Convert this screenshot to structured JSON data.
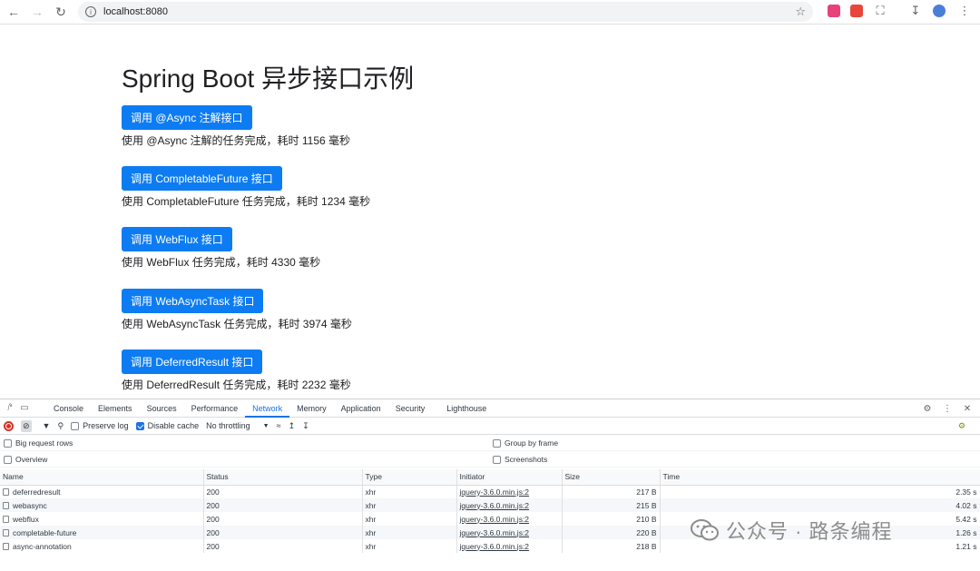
{
  "browser": {
    "url": "localhost:8080",
    "back_icon": "back-arrow-icon",
    "forward_icon": "forward-arrow-icon",
    "reload_icon": "reload-icon"
  },
  "page": {
    "title": "Spring Boot 异步接口示例",
    "demos": [
      {
        "button": "调用 @Async 注解接口",
        "result": "使用 @Async 注解的任务完成，耗时 1156 毫秒"
      },
      {
        "button": "调用 CompletableFuture 接口",
        "result": "使用 CompletableFuture 任务完成，耗时 1234 毫秒"
      },
      {
        "button": "调用 WebFlux 接口",
        "result": "使用 WebFlux 任务完成，耗时 4330 毫秒"
      },
      {
        "button": "调用 WebAsyncTask 接口",
        "result": "使用 WebAsyncTask 任务完成，耗时 3974 毫秒"
      },
      {
        "button": "调用 DeferredResult 接口",
        "result": "使用 DeferredResult 任务完成，耗时 2232 毫秒"
      }
    ],
    "button_color": "#0d7cf2"
  },
  "devtools": {
    "tabs": [
      "Console",
      "Elements",
      "Sources",
      "Performance",
      "Network",
      "Memory",
      "Application",
      "Security",
      "Lighthouse"
    ],
    "active_tab": "Network",
    "toolbar": {
      "preserve_log": "Preserve log",
      "disable_cache": "Disable cache",
      "throttling": "No throttling"
    },
    "options": {
      "big_rows": "Big request rows",
      "group_by_frame": "Group by frame",
      "overview": "Overview",
      "screenshots": "Screenshots"
    },
    "columns": [
      "Name",
      "Status",
      "Type",
      "Initiator",
      "Size",
      "Time"
    ],
    "rows": [
      {
        "name": "deferredresult",
        "status": "200",
        "type": "xhr",
        "initiator": "jquery-3.6.0.min.js:2",
        "size": "217 B",
        "time": "2.35 s"
      },
      {
        "name": "webasync",
        "status": "200",
        "type": "xhr",
        "initiator": "jquery-3.6.0.min.js:2",
        "size": "215 B",
        "time": "4.02 s"
      },
      {
        "name": "webflux",
        "status": "200",
        "type": "xhr",
        "initiator": "jquery-3.6.0.min.js:2",
        "size": "210 B",
        "time": "5.42 s"
      },
      {
        "name": "completable-future",
        "status": "200",
        "type": "xhr",
        "initiator": "jquery-3.6.0.min.js:2",
        "size": "220 B",
        "time": "1.26 s"
      },
      {
        "name": "async-annotation",
        "status": "200",
        "type": "xhr",
        "initiator": "jquery-3.6.0.min.js:2",
        "size": "218 B",
        "time": "1.21 s"
      }
    ]
  },
  "watermark": "公众号 · 路条编程"
}
